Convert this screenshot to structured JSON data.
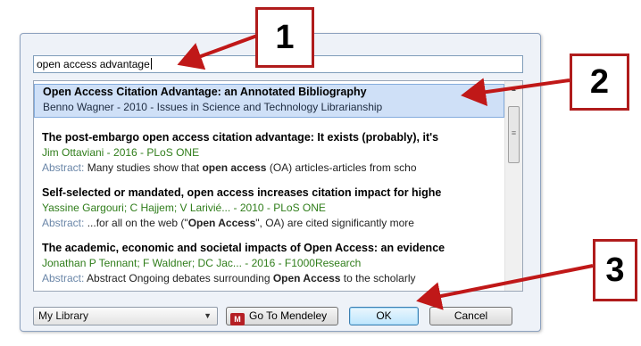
{
  "search": {
    "value": "open access advantage"
  },
  "results": [
    {
      "title": "Open Access Citation Advantage: an Annotated Bibliography",
      "meta": "Benno Wagner - 2010 - Issues in Science and Technology Librarianship",
      "selected": true
    },
    {
      "title": "The post-embargo open access citation advantage: It exists (probably), it's",
      "meta": "Jim Ottaviani - 2016 - PLoS ONE",
      "abstract_label": "Abstract:",
      "abstract_pre": " Many studies show that ",
      "abstract_bold": "open access",
      "abstract_post": " (OA) articles-articles from scho"
    },
    {
      "title": "Self-selected or mandated, open access increases citation impact for highe",
      "meta": "Yassine Gargouri; C Hajjem; V Larivié... - 2010 - PLoS ONE",
      "abstract_label": "Abstract:",
      "abstract_pre": " ...for all on the web (\"",
      "abstract_bold": "Open Access",
      "abstract_post": "\", OA) are cited significantly more"
    },
    {
      "title": "The academic, economic and societal impacts of Open Access: an evidence",
      "meta": "Jonathan P Tennant; F Waldner; DC Jac... - 2016 - F1000Research",
      "abstract_label": "Abstract:",
      "abstract_pre": " Abstract Ongoing debates surrounding ",
      "abstract_bold": "Open Access",
      "abstract_post": " to the scholarly"
    }
  ],
  "footer": {
    "library_select": "My Library",
    "mendeley_icon_text": "M",
    "mendeley_button": "Go To Mendeley",
    "ok_button": "OK",
    "cancel_button": "Cancel"
  },
  "callouts": [
    "1",
    "2",
    "3"
  ],
  "colors": {
    "callout_border": "#b01c1c",
    "arrow": "#c01818",
    "selection": "#cfe0f7",
    "meta_green": "#2f7d1a"
  }
}
